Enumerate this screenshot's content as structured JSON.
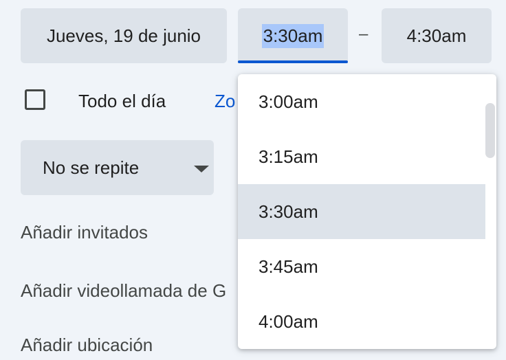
{
  "date": {
    "label": "Jueves, 19 de junio"
  },
  "start_time": {
    "value": "3:30am"
  },
  "separator": "–",
  "end_time": {
    "value": "4:30am"
  },
  "all_day": {
    "label": "Todo el día",
    "checked": false
  },
  "timezone_link": {
    "label": "Zo"
  },
  "repeat": {
    "label": "No se repite"
  },
  "rows": {
    "add_guests": "Añadir invitados",
    "add_video": "Añadir videollamada de G",
    "add_location": "Añadir ubicación"
  },
  "time_menu": {
    "options": [
      "3:00am",
      "3:15am",
      "3:30am",
      "3:45am",
      "4:00am"
    ],
    "selected": "3:30am"
  },
  "colors": {
    "accent": "#0b57d0",
    "chip_bg": "#dde3ea",
    "page_bg": "#f0f4f9",
    "selection": "#a8c7fa"
  }
}
